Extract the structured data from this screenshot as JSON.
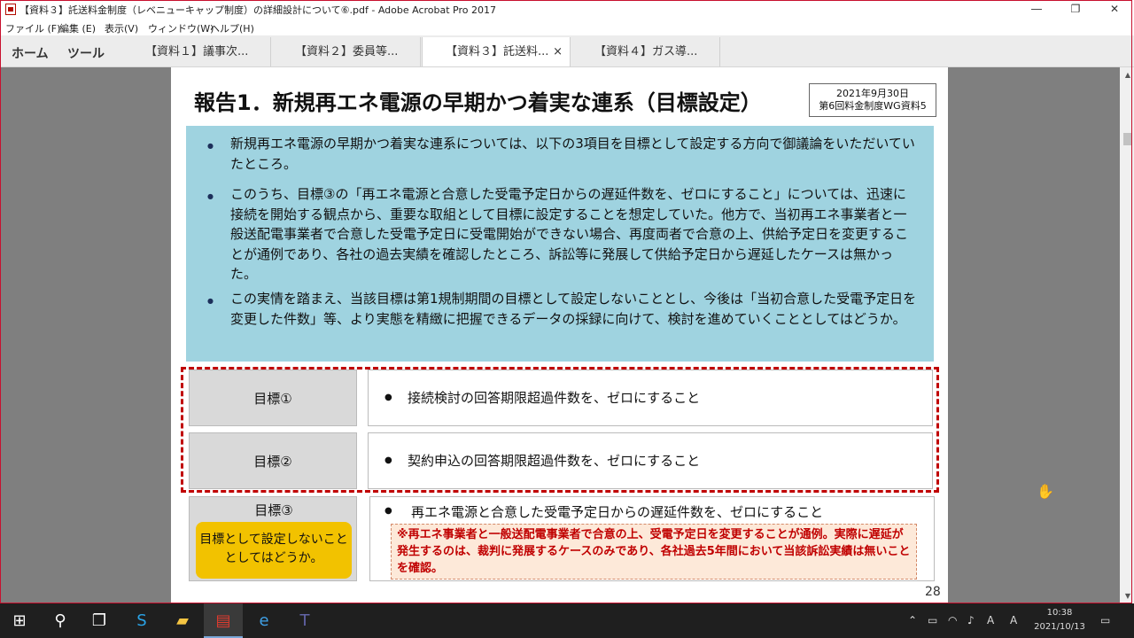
{
  "window": {
    "title": "【資料３】託送料金制度（レベニューキャップ制度）の詳細設計について⑥.pdf - Adobe Acrobat Pro 2017",
    "minimize": "―",
    "restore": "❐",
    "close": "✕"
  },
  "menu": [
    "ファイル (F)",
    "編集 (E)",
    "表示(V)",
    "ウィンドウ(W)",
    "ヘルプ(H)"
  ],
  "nav": {
    "home": "ホーム",
    "tools": "ツール"
  },
  "tabs": [
    {
      "label": "【資料１】議事次..."
    },
    {
      "label": "【資料２】委員等..."
    },
    {
      "label": "【資料３】託送料..."
    },
    {
      "label": "【資料４】ガス導..."
    }
  ],
  "tab_close": "×",
  "slide": {
    "title": "報告1．新規再エネ電源の早期かつ着実な連系（目標設定）",
    "date_line1": "2021年9月30日",
    "date_line2": "第6回料金制度WG資料5",
    "bullets": [
      "新規再エネ電源の早期かつ着実な連系については、以下の3項目を目標として設定する方向で御議論をいただいていたところ。",
      "このうち、目標③の「再エネ電源と合意した受電予定日からの遅延件数を、ゼロにすること」については、迅速に接続を開始する観点から、重要な取組として目標に設定することを想定していた。他方で、当初再エネ事業者と一般送配電事業者で合意した受電予定日に受電開始ができない場合、再度両者で合意の上、供給予定日を変更することが通例であり、各社の過去実績を確認したところ、訴訟等に発展して供給予定日から遅延したケースは無かった。",
      "この実情を踏まえ、当該目標は第1規制期間の目標として設定しないこととし、今後は「当初合意した受電予定日を変更した件数」等、より実態を精緻に把握できるデータの採録に向けて、検討を進めていくこととしてはどうか。"
    ],
    "goal1_label": "目標①",
    "goal1_text": "接続検討の回答期限超過件数を、ゼロにすること",
    "goal2_label": "目標②",
    "goal2_text": "契約申込の回答期限超過件数を、ゼロにすること",
    "goal3_label": "目標③",
    "goal3_text": "再エネ電源と合意した受電予定日からの遅延件数を、ゼロにすること",
    "goal3_note": "目標として設定しないこととしてはどうか。",
    "goal3_remark": "※再エネ事業者と一般送配電事業者で合意の上、受電予定日を変更することが通例。実際に遅延が発生するのは、裁判に発展するケースのみであり、各社過去5年間において当該訴訟実績は無いことを確認。",
    "page_number": "28",
    "bullet_glyph": "●"
  },
  "taskbar": {
    "time": "10:38",
    "date": "2021/10/13",
    "apps": [
      "start-icon",
      "search-icon",
      "task-view-icon",
      "skype-icon",
      "file-explorer-icon",
      "acrobat-icon",
      "edge-icon",
      "teams-icon"
    ]
  },
  "colors": {
    "accent_red": "#c00000",
    "blue_box": "#9fd3e0",
    "yellow_note": "#f2c200"
  }
}
